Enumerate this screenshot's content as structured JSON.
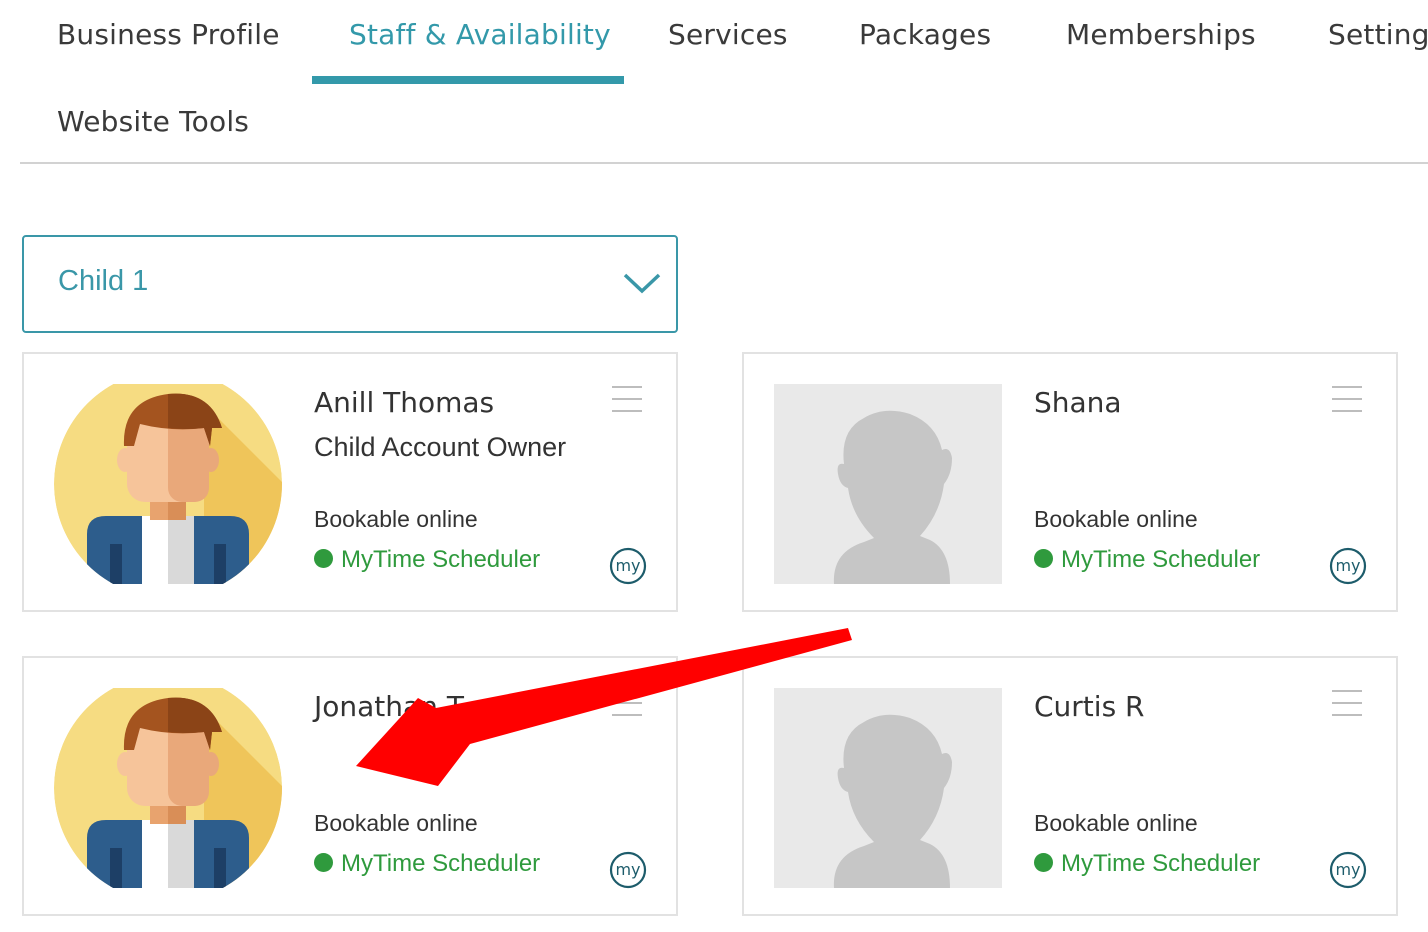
{
  "tabs": [
    {
      "label": "Business Profile",
      "active": false
    },
    {
      "label": "Staff & Availability",
      "active": true
    },
    {
      "label": "Services",
      "active": false
    },
    {
      "label": "Packages",
      "active": false
    },
    {
      "label": "Memberships",
      "active": false
    },
    {
      "label": "Settings",
      "active": false
    },
    {
      "label": "Website Tools",
      "active": false
    }
  ],
  "location_select": {
    "value": "Child 1"
  },
  "staff": [
    {
      "name": "Anill Thomas",
      "role": "Child Account Owner",
      "bookable": "Bookable online",
      "scheduler": "MyTime Scheduler",
      "avatar": "illustrated-avatar"
    },
    {
      "name": "Shana",
      "role": "",
      "bookable": "Bookable online",
      "scheduler": "MyTime Scheduler",
      "avatar": "placeholder-silhouette"
    },
    {
      "name": "Jonathan T",
      "role": "",
      "bookable": "Bookable online",
      "scheduler": "MyTime Scheduler",
      "avatar": "illustrated-avatar"
    },
    {
      "name": "Curtis R",
      "role": "",
      "bookable": "Bookable online",
      "scheduler": "MyTime Scheduler",
      "avatar": "placeholder-silhouette"
    }
  ],
  "colors": {
    "accent": "#3399aa",
    "status_green": "#2f9a3d",
    "annotation_arrow": "#ff0000"
  },
  "icons": {
    "dropdown": "chevron-down-icon",
    "card_menu": "hamburger-menu-icon",
    "scheduler": "mytime-logo-icon",
    "status": "green-dot-icon"
  }
}
